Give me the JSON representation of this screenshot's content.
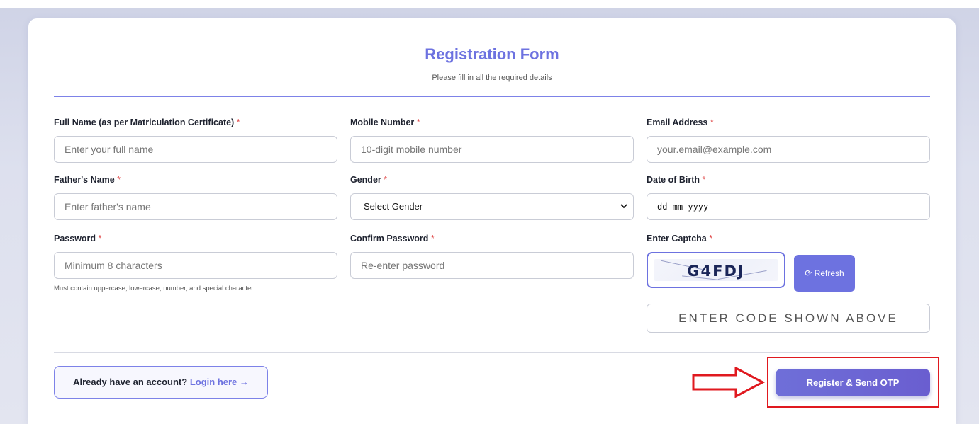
{
  "form": {
    "title": "Registration Form",
    "subtitle": "Please fill in all the required details",
    "required_marker": "*",
    "fields": {
      "full_name": {
        "label": "Full Name (as per Matriculation Certificate)",
        "placeholder": "Enter your full name"
      },
      "mobile": {
        "label": "Mobile Number",
        "placeholder": "10-digit mobile number"
      },
      "email": {
        "label": "Email Address",
        "placeholder": "your.email@example.com"
      },
      "father_name": {
        "label": "Father's Name",
        "placeholder": "Enter father's name"
      },
      "gender": {
        "label": "Gender",
        "selected": "Select Gender"
      },
      "dob": {
        "label": "Date of Birth",
        "value": "dd-mm-yyyy"
      },
      "password": {
        "label": "Password",
        "placeholder": "Minimum 8 characters",
        "hint": "Must contain uppercase, lowercase, number, and special character"
      },
      "confirm_password": {
        "label": "Confirm Password",
        "placeholder": "Re-enter password"
      },
      "captcha": {
        "label": "Enter Captcha",
        "code": "G4FDJ",
        "refresh_label": "⟳ Refresh",
        "placeholder": "ENTER CODE SHOWN ABOVE"
      }
    },
    "footer": {
      "login_prefix": "Already have an account?",
      "login_link": "Login here →",
      "register_label": "Register & Send OTP"
    }
  },
  "colors": {
    "accent": "#6d72e0",
    "required": "#e04a4a",
    "annotation": "#e0191f"
  },
  "icons": {
    "refresh": "refresh-icon",
    "select_chevron": "chevron-down-icon",
    "annotation_arrow": "right-arrow-icon"
  }
}
